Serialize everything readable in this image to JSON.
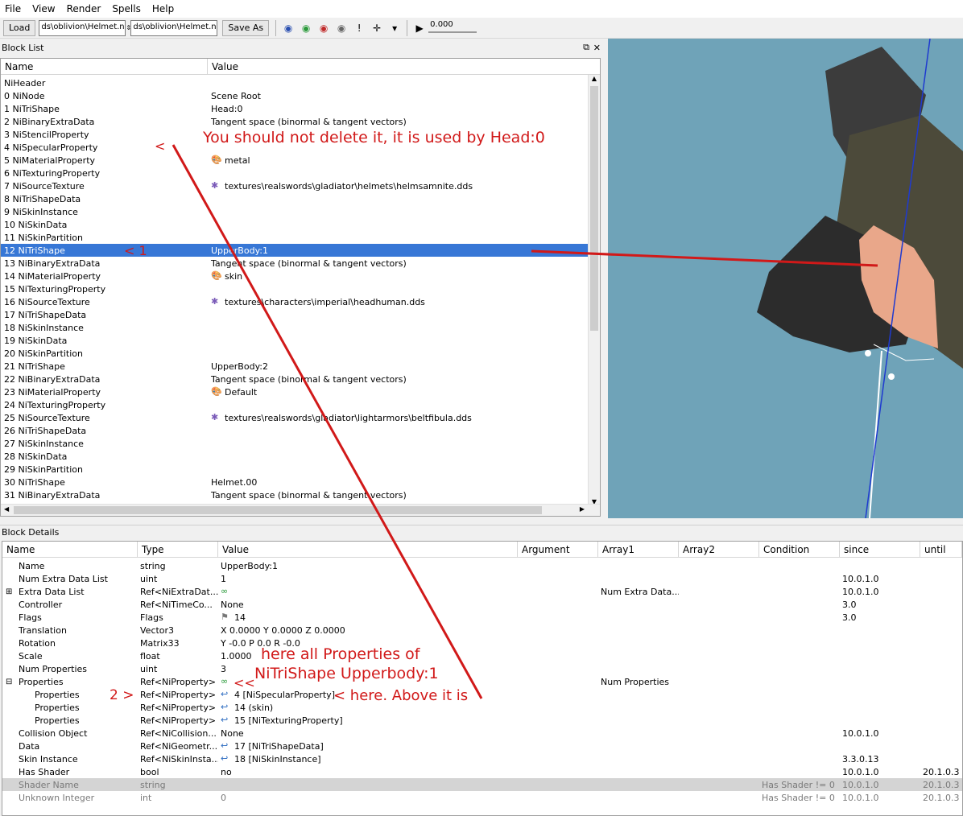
{
  "menu": [
    "File",
    "View",
    "Render",
    "Spells",
    "Help"
  ],
  "toolbar": {
    "load_label": "Load",
    "load_path": "ds\\oblivion\\Helmet.nif",
    "save_path": "ds\\oblivion\\Helmet.nif",
    "save_as_label": "Save As",
    "time_value": "0.000"
  },
  "block_list": {
    "title": "Block List",
    "col_name": "Name",
    "col_value": "Value",
    "rows": [
      {
        "name": "NiHeader",
        "value": "",
        "icon": ""
      },
      {
        "name": "0  NiNode",
        "value": "Scene Root",
        "icon": ""
      },
      {
        "name": "1  NiTriShape",
        "value": "Head:0",
        "icon": ""
      },
      {
        "name": "2  NiBinaryExtraData",
        "value": "Tangent space (binormal & tangent vectors)",
        "icon": ""
      },
      {
        "name": "3  NiStencilProperty",
        "value": "",
        "icon": ""
      },
      {
        "name": "4  NiSpecularProperty",
        "value": "",
        "icon": ""
      },
      {
        "name": "5  NiMaterialProperty",
        "value": "metal",
        "icon": "palette"
      },
      {
        "name": "6  NiTexturingProperty",
        "value": "",
        "icon": ""
      },
      {
        "name": "7  NiSourceTexture",
        "value": "textures\\realswords\\gladiator\\helmets\\helmsamnite.dds",
        "icon": "texture"
      },
      {
        "name": "8  NiTriShapeData",
        "value": "",
        "icon": ""
      },
      {
        "name": "9  NiSkinInstance",
        "value": "",
        "icon": ""
      },
      {
        "name": "10  NiSkinData",
        "value": "",
        "icon": ""
      },
      {
        "name": "11  NiSkinPartition",
        "value": "",
        "icon": ""
      },
      {
        "name": "12  NiTriShape",
        "value": "UpperBody:1",
        "icon": "",
        "selected": true
      },
      {
        "name": "13  NiBinaryExtraData",
        "value": "Tangent space (binormal & tangent vectors)",
        "icon": ""
      },
      {
        "name": "14  NiMaterialProperty",
        "value": "skin",
        "icon": "palette"
      },
      {
        "name": "15  NiTexturingProperty",
        "value": "",
        "icon": ""
      },
      {
        "name": "16  NiSourceTexture",
        "value": "textures\\characters\\imperial\\headhuman.dds",
        "icon": "texture"
      },
      {
        "name": "17  NiTriShapeData",
        "value": "",
        "icon": ""
      },
      {
        "name": "18  NiSkinInstance",
        "value": "",
        "icon": ""
      },
      {
        "name": "19  NiSkinData",
        "value": "",
        "icon": ""
      },
      {
        "name": "20  NiSkinPartition",
        "value": "",
        "icon": ""
      },
      {
        "name": "21  NiTriShape",
        "value": "UpperBody:2",
        "icon": ""
      },
      {
        "name": "22  NiBinaryExtraData",
        "value": "Tangent space (binormal & tangent vectors)",
        "icon": ""
      },
      {
        "name": "23  NiMaterialProperty",
        "value": "Default",
        "icon": "palette"
      },
      {
        "name": "24  NiTexturingProperty",
        "value": "",
        "icon": ""
      },
      {
        "name": "25  NiSourceTexture",
        "value": "textures\\realswords\\gladiator\\lightarmors\\beltfibula.dds",
        "icon": "texture"
      },
      {
        "name": "26  NiTriShapeData",
        "value": "",
        "icon": ""
      },
      {
        "name": "27  NiSkinInstance",
        "value": "",
        "icon": ""
      },
      {
        "name": "28  NiSkinData",
        "value": "",
        "icon": ""
      },
      {
        "name": "29  NiSkinPartition",
        "value": "",
        "icon": ""
      },
      {
        "name": "30  NiTriShape",
        "value": "Helmet.00",
        "icon": ""
      },
      {
        "name": "31  NiBinaryExtraData",
        "value": "Tangent space (binormal & tangent vectors)",
        "icon": ""
      }
    ]
  },
  "block_details": {
    "title": "Block Details",
    "columns": [
      "Name",
      "Type",
      "Value",
      "Argument",
      "Array1",
      "Array2",
      "Condition",
      "since",
      "until"
    ],
    "rows": [
      {
        "name": "Name",
        "type": "string",
        "value": "UpperBody:1",
        "arg": "",
        "array1": "",
        "array2": "",
        "cond": "",
        "since": "",
        "until": "",
        "indent": 1,
        "icon": ""
      },
      {
        "name": "Num Extra Data List",
        "type": "uint",
        "value": "1",
        "arg": "",
        "array1": "",
        "array2": "",
        "cond": "",
        "since": "10.0.1.0",
        "until": "",
        "indent": 1,
        "icon": ""
      },
      {
        "name": "Extra Data List",
        "type": "Ref<NiExtraDat...",
        "value": "",
        "arg": "",
        "array1": "Num Extra Data...",
        "array2": "",
        "cond": "",
        "since": "10.0.1.0",
        "until": "",
        "indent": 1,
        "icon": "links",
        "expander": "+"
      },
      {
        "name": "Controller",
        "type": "Ref<NiTimeCo...",
        "value": "None",
        "arg": "",
        "array1": "",
        "array2": "",
        "cond": "",
        "since": "3.0",
        "until": "",
        "indent": 1,
        "icon": ""
      },
      {
        "name": "Flags",
        "type": "Flags",
        "value": "14",
        "arg": "",
        "array1": "",
        "array2": "",
        "cond": "",
        "since": "3.0",
        "until": "",
        "indent": 1,
        "icon": "flag"
      },
      {
        "name": "Translation",
        "type": "Vector3",
        "value": "X 0.0000 Y 0.0000 Z 0.0000",
        "arg": "",
        "array1": "",
        "array2": "",
        "cond": "",
        "since": "",
        "until": "",
        "indent": 1,
        "icon": ""
      },
      {
        "name": "Rotation",
        "type": "Matrix33",
        "value": "Y -0.0 P 0.0 R -0.0",
        "arg": "",
        "array1": "",
        "array2": "",
        "cond": "",
        "since": "",
        "until": "",
        "indent": 1,
        "icon": ""
      },
      {
        "name": "Scale",
        "type": "float",
        "value": "1.0000",
        "arg": "",
        "array1": "",
        "array2": "",
        "cond": "",
        "since": "",
        "until": "",
        "indent": 1,
        "icon": ""
      },
      {
        "name": "Num Properties",
        "type": "uint",
        "value": "3",
        "arg": "",
        "array1": "",
        "array2": "",
        "cond": "",
        "since": "",
        "until": "",
        "indent": 1,
        "icon": ""
      },
      {
        "name": "Properties",
        "type": "Ref<NiProperty>",
        "value": "",
        "arg": "",
        "array1": "Num Properties",
        "array2": "",
        "cond": "",
        "since": "",
        "until": "",
        "indent": 1,
        "icon": "links",
        "expander": "-"
      },
      {
        "name": "Properties",
        "type": "Ref<NiProperty>",
        "value": "4 [NiSpecularProperty]",
        "arg": "",
        "array1": "",
        "array2": "",
        "cond": "",
        "since": "",
        "until": "",
        "indent": 2,
        "icon": "link"
      },
      {
        "name": "Properties",
        "type": "Ref<NiProperty>",
        "value": "14 (skin)",
        "arg": "",
        "array1": "",
        "array2": "",
        "cond": "",
        "since": "",
        "until": "",
        "indent": 2,
        "icon": "link"
      },
      {
        "name": "Properties",
        "type": "Ref<NiProperty>",
        "value": "15 [NiTexturingProperty]",
        "arg": "",
        "array1": "",
        "array2": "",
        "cond": "",
        "since": "",
        "until": "",
        "indent": 2,
        "icon": "link"
      },
      {
        "name": "Collision Object",
        "type": "Ref<NiCollision...",
        "value": "None",
        "arg": "",
        "array1": "",
        "array2": "",
        "cond": "",
        "since": "10.0.1.0",
        "until": "",
        "indent": 1,
        "icon": ""
      },
      {
        "name": "Data",
        "type": "Ref<NiGeometr...",
        "value": "17 [NiTriShapeData]",
        "arg": "",
        "array1": "",
        "array2": "",
        "cond": "",
        "since": "",
        "until": "",
        "indent": 1,
        "icon": "link"
      },
      {
        "name": "Skin Instance",
        "type": "Ref<NiSkinInsta...",
        "value": "18 [NiSkinInstance]",
        "arg": "",
        "array1": "",
        "array2": "",
        "cond": "",
        "since": "3.3.0.13",
        "until": "",
        "indent": 1,
        "icon": "link"
      },
      {
        "name": "Has Shader",
        "type": "bool",
        "value": "no",
        "arg": "",
        "array1": "",
        "array2": "",
        "cond": "",
        "since": "10.0.1.0",
        "until": "20.1.0.3",
        "indent": 1,
        "icon": ""
      },
      {
        "name": "Shader Name",
        "type": "string",
        "value": "",
        "arg": "",
        "array1": "",
        "array2": "",
        "cond": "Has Shader != 0",
        "since": "10.0.1.0",
        "until": "20.1.0.3",
        "indent": 1,
        "icon": "",
        "style": "grey"
      },
      {
        "name": "Unknown Integer",
        "type": "int",
        "value": "0",
        "arg": "",
        "array1": "",
        "array2": "",
        "cond": "Has Shader != 0",
        "since": "10.0.1.0",
        "until": "20.1.0.3",
        "indent": 1,
        "icon": "",
        "style": "dim"
      }
    ]
  },
  "annotations": {
    "not_delete": "You should not delete it, it is used by Head:0",
    "arrow_4": "<",
    "arrow_12": "< 1",
    "props_line1": "here all Properties of",
    "props_line2": "NiTriShape Upperbody:1",
    "props_marker": "<<",
    "two_marker": "2 >",
    "here_above": "< here. Above it is"
  },
  "colors": {
    "selection": "#3777d6",
    "annotation": "#d11919",
    "viewport_bg": "#6fa3b8"
  }
}
